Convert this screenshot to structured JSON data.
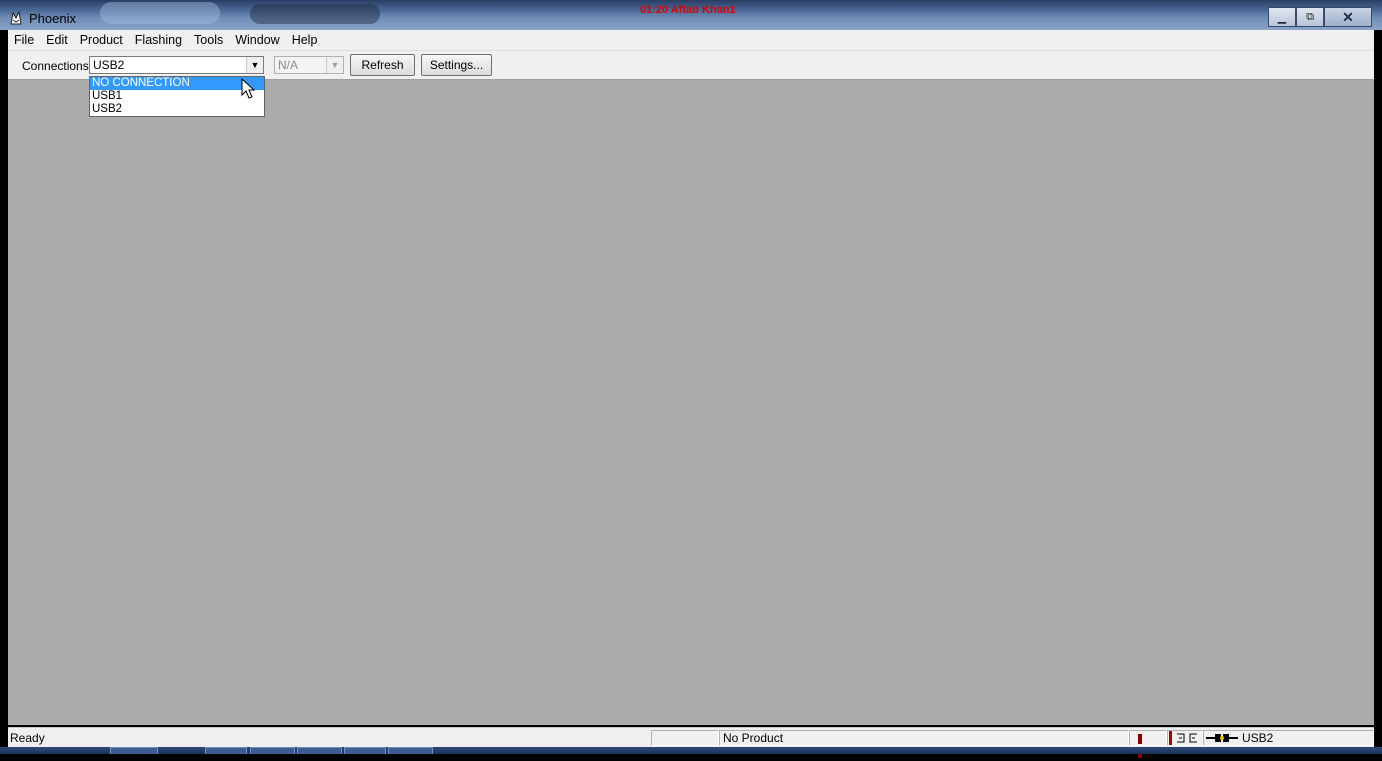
{
  "window": {
    "title": "Phoenix",
    "overlay_text": "01:20 Aftab Khan1",
    "minimize_glyph": "▁",
    "maximize_glyph": "⧉",
    "close_glyph": "✕"
  },
  "menu": {
    "items": [
      "File",
      "Edit",
      "Product",
      "Flashing",
      "Tools",
      "Window",
      "Help"
    ]
  },
  "toolbar": {
    "connections_label": "Connections:",
    "connection_value": "USB2",
    "secondary_value": "N/A",
    "refresh_label": "Refresh",
    "settings_label": "Settings...",
    "arrow_glyph": "▼"
  },
  "dropdown": {
    "options": [
      "NO CONNECTION",
      "USB1",
      "USB2"
    ],
    "highlighted": "NO CONNECTION"
  },
  "statusbar": {
    "ready_text": "Ready",
    "product_text": "No Product",
    "connection_text": "USB2"
  },
  "icons": {
    "app": "phoenix-app-icon",
    "pause": "pause-icon",
    "cable": "usb-cable-icon"
  },
  "colors": {
    "selection": "#3399ff",
    "workspace": "#ababab",
    "overlay_text": "#e00000"
  }
}
